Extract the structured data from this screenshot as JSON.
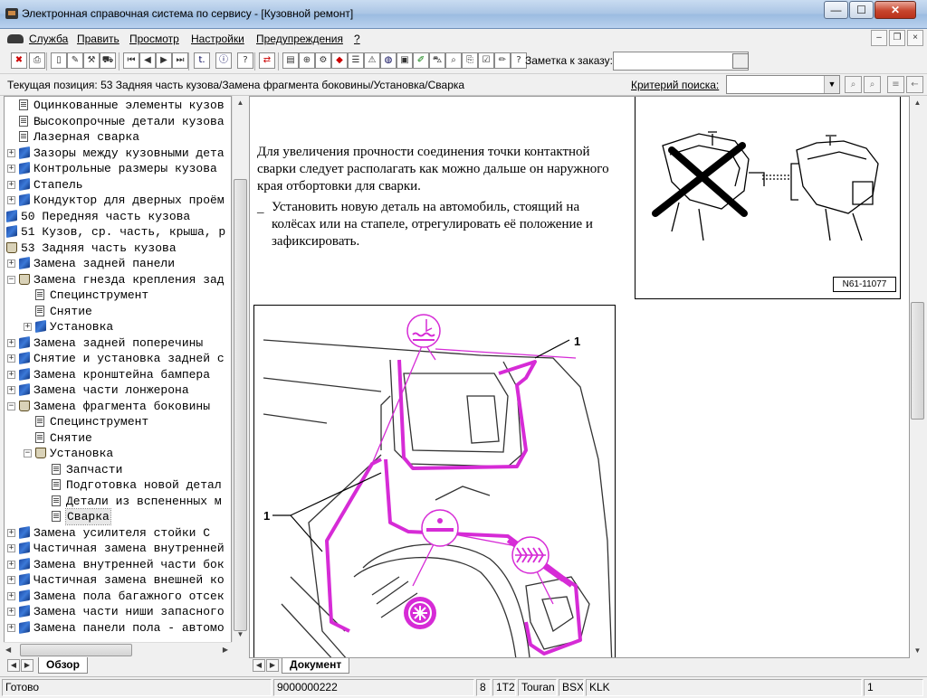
{
  "window": {
    "title": "Электронная справочная система по сервису - [Кузовной ремонт]",
    "min_glyph": "—",
    "max_glyph": "☐",
    "close_glyph": "✕"
  },
  "menu": {
    "items": [
      "Служба",
      "Править",
      "Просмотр",
      "Настройки",
      "Предупреждения",
      "?"
    ],
    "mdi_min": "–",
    "mdi_restore": "❐",
    "mdi_close": "×"
  },
  "toolbar": {
    "note_label": "Заметка к заказу:",
    "note_value": "",
    "buttons": [
      {
        "name": "warning-icon",
        "glyph": "✖",
        "color": "red"
      },
      {
        "name": "print-icon",
        "glyph": "⎙",
        "color": ""
      },
      {
        "name": "new-doc-icon",
        "glyph": "▯",
        "color": ""
      },
      {
        "name": "edit-icon",
        "glyph": "✎",
        "color": ""
      },
      {
        "name": "tools-icon",
        "glyph": "⚒",
        "color": ""
      },
      {
        "name": "car-icon",
        "glyph": "⛟",
        "color": ""
      },
      {
        "name": "first-icon",
        "glyph": "⏮",
        "color": ""
      },
      {
        "name": "prev-icon",
        "glyph": "◀",
        "color": ""
      },
      {
        "name": "next-icon",
        "glyph": "▶",
        "color": ""
      },
      {
        "name": "last-icon",
        "glyph": "⏭",
        "color": ""
      },
      {
        "name": "back-icon",
        "glyph": "t.",
        "color": "blue"
      },
      {
        "name": "info-icon",
        "glyph": "ⓘ",
        "color": "blue"
      },
      {
        "name": "help-icon",
        "glyph": "?",
        "color": ""
      },
      {
        "name": "swap-icon",
        "glyph": "⇄",
        "color": "red"
      },
      {
        "name": "book-icon",
        "glyph": "▤",
        "color": ""
      },
      {
        "name": "globe-icon",
        "glyph": "⊕",
        "color": ""
      },
      {
        "name": "gear-icon",
        "glyph": "⚙",
        "color": ""
      },
      {
        "name": "tag-icon",
        "glyph": "◆",
        "color": "red"
      },
      {
        "name": "list-icon",
        "glyph": "☰",
        "color": ""
      },
      {
        "name": "alert-icon",
        "glyph": "⚠",
        "color": ""
      },
      {
        "name": "earth-icon",
        "glyph": "◍",
        "color": "blue"
      },
      {
        "name": "save-icon",
        "glyph": "▣",
        "color": ""
      },
      {
        "name": "brush-icon",
        "glyph": "✐",
        "color": "green"
      },
      {
        "name": "vehicle-icon",
        "glyph": "⛍",
        "color": ""
      },
      {
        "name": "search-icon",
        "glyph": "⌕",
        "color": ""
      },
      {
        "name": "copy-icon",
        "glyph": "⎘",
        "color": ""
      },
      {
        "name": "check-icon",
        "glyph": "☑",
        "color": ""
      },
      {
        "name": "pencil-icon",
        "glyph": "✏",
        "color": ""
      },
      {
        "name": "question-icon",
        "glyph": "?",
        "color": ""
      }
    ]
  },
  "position": {
    "label": "Текущая позиция: 53 Задняя часть кузова/Замена фрагмента боковины/Установка/Сварка",
    "criteria_label": "Критерий поиска:",
    "criteria_value": ""
  },
  "tree": [
    {
      "level": 1,
      "icon": "page",
      "exp": "",
      "label": "Оцинкованные элементы кузов"
    },
    {
      "level": 1,
      "icon": "page",
      "exp": "",
      "label": "Высокопрочные детали кузова"
    },
    {
      "level": 1,
      "icon": "page",
      "exp": "",
      "label": "Лазерная сварка"
    },
    {
      "level": 1,
      "icon": "book",
      "exp": "+",
      "label": "Зазоры между кузовными дета"
    },
    {
      "level": 1,
      "icon": "book",
      "exp": "+",
      "label": "Контрольные размеры кузова"
    },
    {
      "level": 1,
      "icon": "book",
      "exp": "+",
      "label": "Стапель"
    },
    {
      "level": 1,
      "icon": "book",
      "exp": "+",
      "label": "Кондуктор для дверных проём"
    },
    {
      "level": 0,
      "icon": "book",
      "exp": "",
      "label": "50 Передняя часть кузова"
    },
    {
      "level": 0,
      "icon": "book",
      "exp": "",
      "label": "51 Кузов, ср. часть, крыша, р"
    },
    {
      "level": 0,
      "icon": "open",
      "exp": "",
      "label": "53 Задняя часть кузова"
    },
    {
      "level": 1,
      "icon": "book",
      "exp": "+",
      "label": "Замена задней панели"
    },
    {
      "level": 1,
      "icon": "open",
      "exp": "-",
      "label": "Замена гнезда крепления зад"
    },
    {
      "level": 2,
      "icon": "page",
      "exp": "",
      "label": "Специнструмент"
    },
    {
      "level": 2,
      "icon": "page",
      "exp": "",
      "label": "Снятие"
    },
    {
      "level": 2,
      "icon": "book",
      "exp": "+",
      "label": "Установка"
    },
    {
      "level": 1,
      "icon": "book",
      "exp": "+",
      "label": "Замена задней поперечины"
    },
    {
      "level": 1,
      "icon": "book",
      "exp": "+",
      "label": "Снятие и установка задней с"
    },
    {
      "level": 1,
      "icon": "book",
      "exp": "+",
      "label": "Замена кронштейна бампера"
    },
    {
      "level": 1,
      "icon": "book",
      "exp": "+",
      "label": "Замена части лонжерона"
    },
    {
      "level": 1,
      "icon": "open",
      "exp": "-",
      "label": "Замена фрагмента боковины"
    },
    {
      "level": 2,
      "icon": "page",
      "exp": "",
      "label": "Специнструмент"
    },
    {
      "level": 2,
      "icon": "page",
      "exp": "",
      "label": "Снятие"
    },
    {
      "level": 2,
      "icon": "open",
      "exp": "-",
      "label": "Установка"
    },
    {
      "level": 3,
      "icon": "page",
      "exp": "",
      "label": "Запчасти"
    },
    {
      "level": 3,
      "icon": "page",
      "exp": "",
      "label": "Подготовка новой детал"
    },
    {
      "level": 3,
      "icon": "page",
      "exp": "",
      "label": "Детали из вспененных м"
    },
    {
      "level": 3,
      "icon": "page",
      "exp": "",
      "label": "Сварка",
      "selected": true
    },
    {
      "level": 1,
      "icon": "book",
      "exp": "+",
      "label": "Замена усилителя стойки С"
    },
    {
      "level": 1,
      "icon": "book",
      "exp": "+",
      "label": "Частичная замена внутренней"
    },
    {
      "level": 1,
      "icon": "book",
      "exp": "+",
      "label": "Замена внутренней части бок"
    },
    {
      "level": 1,
      "icon": "book",
      "exp": "+",
      "label": "Частичная замена внешней ко"
    },
    {
      "level": 1,
      "icon": "book",
      "exp": "+",
      "label": "Замена пола багажного отсек"
    },
    {
      "level": 1,
      "icon": "book",
      "exp": "+",
      "label": "Замена части ниши запасного"
    },
    {
      "level": 1,
      "icon": "book",
      "exp": "+",
      "label": "Замена панели пола - автомо"
    }
  ],
  "tabs": {
    "left": "Обзор",
    "right": "Документ"
  },
  "document": {
    "paragraph": "Для увеличения прочности соединения точки контактной сварки следует располагать как можно дальше он наружного края отбортовки для сварки.",
    "step_dash": "–",
    "step": "Установить новую деталь на автомобиль, стоящий на колёсах или на стапеле, отрегулировать её положение и зафиксировать.",
    "figure1_code": "N61-11077",
    "callout_1_top": "1",
    "callout_1_left": "1"
  },
  "status": {
    "ready": "Готово",
    "code": "9000000222",
    "num": "8",
    "engine_code": "1T2",
    "model": "Touran",
    "c1": "BSX",
    "c2": "KLK",
    "page": "1"
  },
  "colors": {
    "accent_magenta": "#d62bd6",
    "tree_blue": "#1f4ea8"
  }
}
